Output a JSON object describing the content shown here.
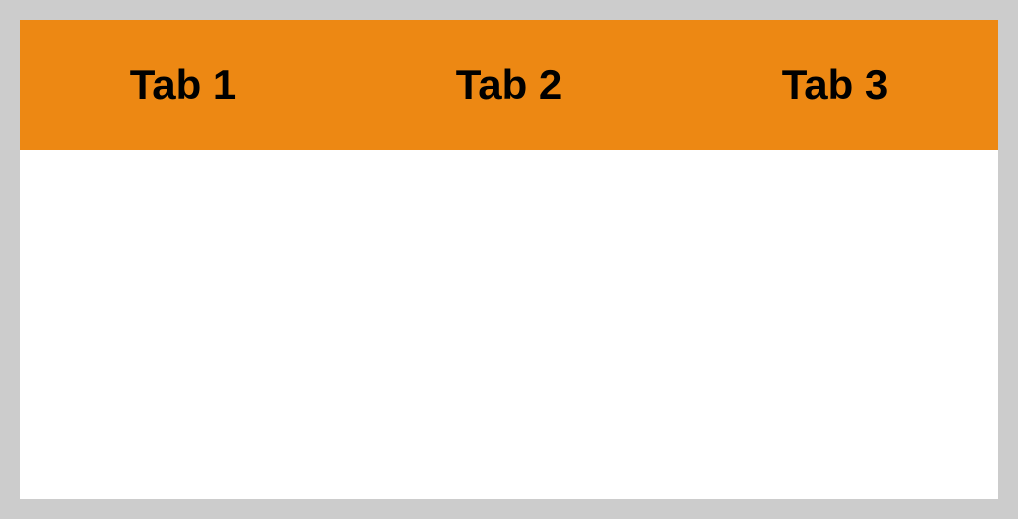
{
  "tabs": [
    {
      "label": "Tab 1"
    },
    {
      "label": "Tab 2"
    },
    {
      "label": "Tab 3"
    }
  ]
}
